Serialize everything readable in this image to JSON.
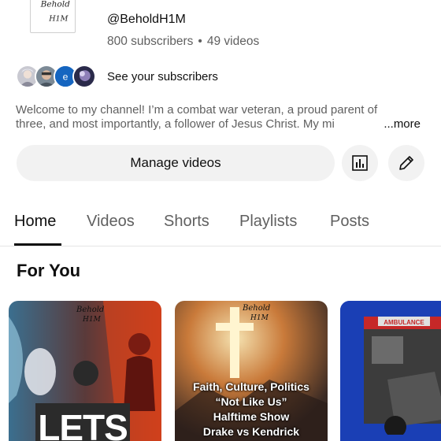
{
  "channel": {
    "handle": "@BeholdH1M",
    "subscribers": "800 subscribers",
    "separator": "•",
    "videos": "49 videos",
    "logo_text": "Behold H1M",
    "see_subscribers": "See your subscribers",
    "description_line1": "Welcome to my channel! I’m a combat war veteran, a proud parent of",
    "description_line2": "three, and most importantly, a follower of Jesus Christ. My mi",
    "more_label": "...more"
  },
  "actions": {
    "manage_videos": "Manage videos",
    "analytics_icon": "analytics-icon",
    "edit_icon": "pencil-icon"
  },
  "tabs": [
    {
      "label": "Home",
      "active": true
    },
    {
      "label": "Videos",
      "active": false
    },
    {
      "label": "Shorts",
      "active": false
    },
    {
      "label": "Playlists",
      "active": false
    },
    {
      "label": "Posts",
      "active": false
    }
  ],
  "section": {
    "title": "For You"
  },
  "videos": [
    {
      "overlay": "LETS",
      "logo": "Behold H1M"
    },
    {
      "lines": [
        "Faith, Culture, Politics",
        "“Not Like Us”",
        "Halftime Show",
        "Drake vs Kendrick"
      ],
      "logo": "Behold H1M"
    },
    {
      "sign": "AMBULANCE"
    }
  ],
  "colors": {
    "primary_text": "#0f0f0f",
    "secondary_text": "#606060",
    "button_bg": "#f2f2f2",
    "avatar_e_bg": "#1565c0"
  }
}
